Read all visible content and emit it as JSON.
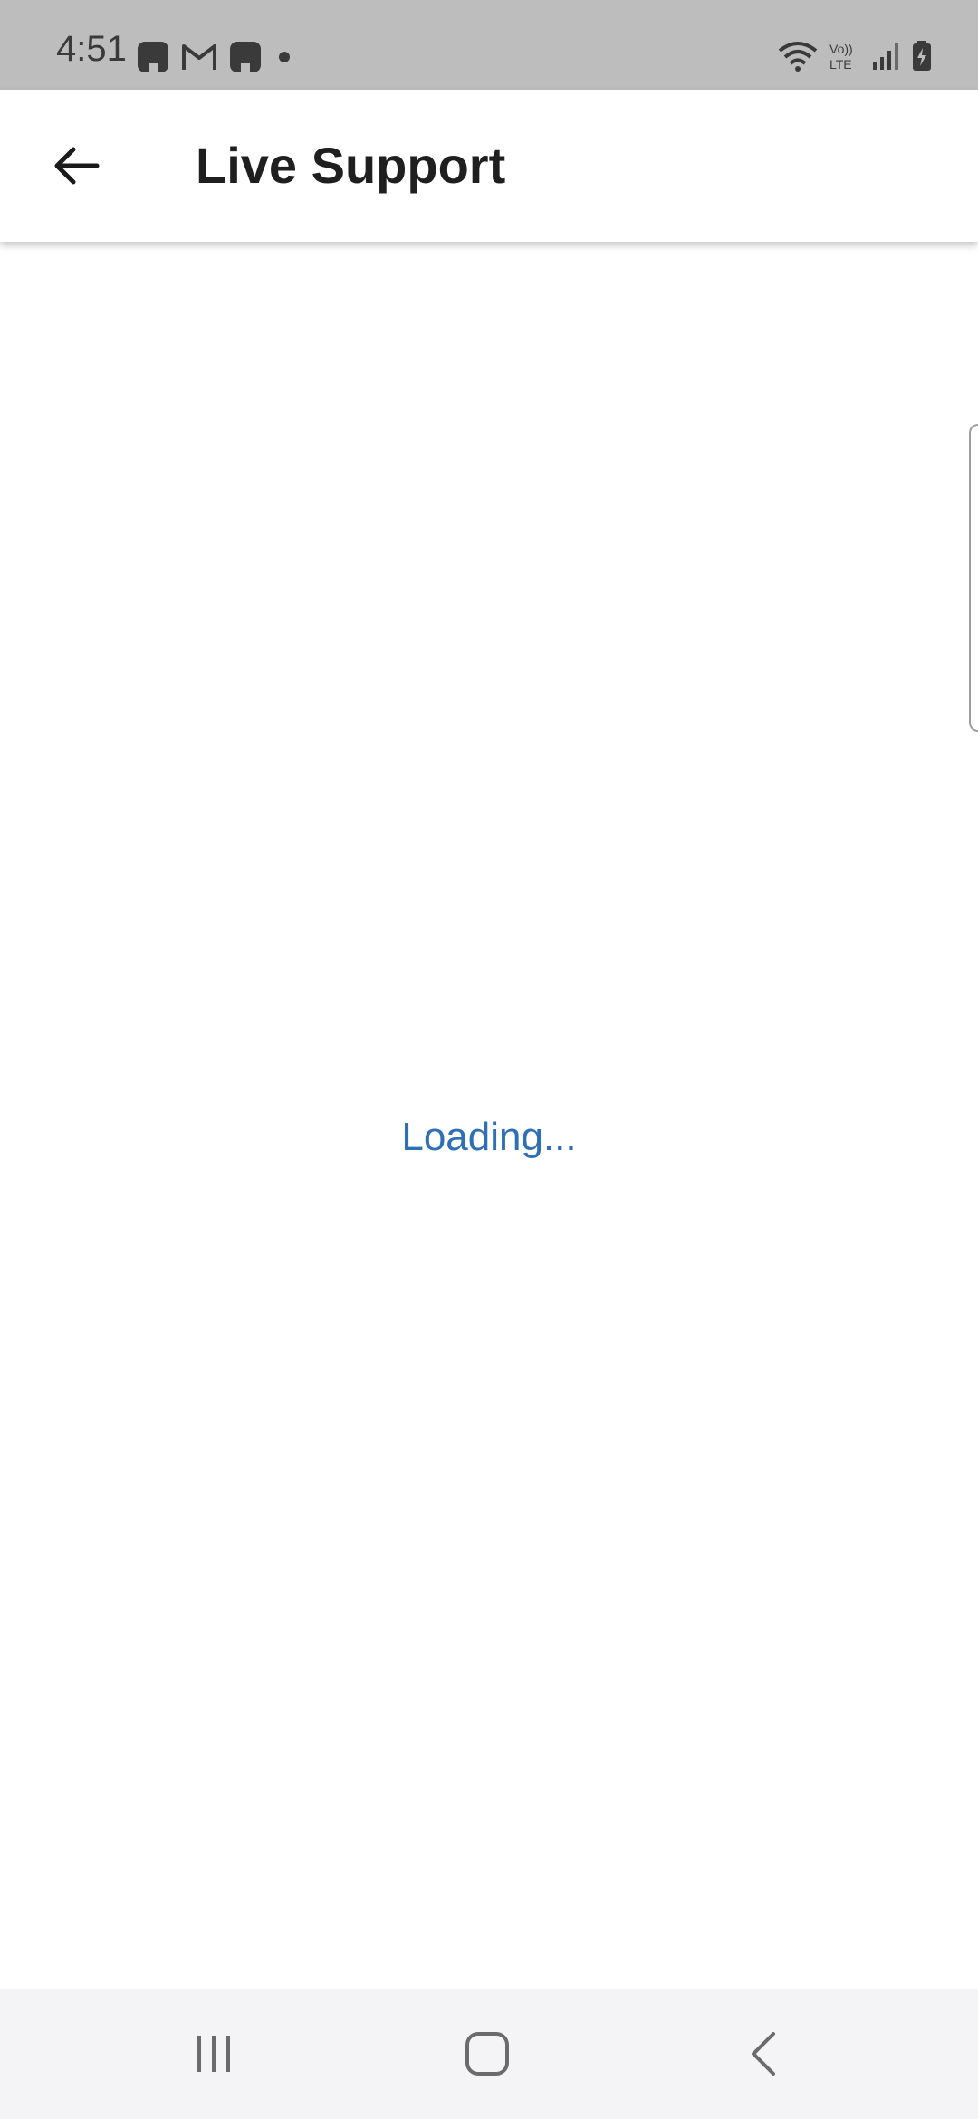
{
  "status_bar": {
    "time": "4:51",
    "left_icons": [
      "notification-app-icon",
      "gmail-icon",
      "notification-app-icon",
      "dot-icon"
    ],
    "right_icons": [
      "wifi-icon",
      "volte-icon",
      "signal-icon",
      "battery-charging-icon"
    ],
    "volte_label": "Vo)) LTE"
  },
  "app_bar": {
    "title": "Live Support",
    "back_icon": "arrow-left-icon"
  },
  "content": {
    "loading_text": "Loading..."
  },
  "nav_bar": {
    "items": [
      "recents-icon",
      "home-icon",
      "back-icon"
    ]
  },
  "colors": {
    "status_bar_bg": "#bdbdbd",
    "loading_text": "#2f6fb5",
    "title_text": "#1f1f1f",
    "nav_bar_bg": "#f4f4f6"
  }
}
